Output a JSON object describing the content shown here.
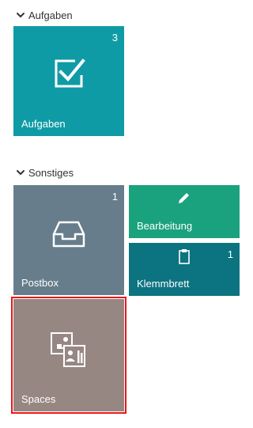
{
  "sections": [
    {
      "title": "Aufgaben",
      "tiles": [
        {
          "label": "Aufgaben",
          "count": "3",
          "icon": "checkbox-icon",
          "color": "#0f9ba5"
        }
      ]
    },
    {
      "title": "Sonstiges",
      "tiles": [
        {
          "label": "Postbox",
          "count": "1",
          "icon": "inbox-tray-icon",
          "color": "#677d8b"
        },
        {
          "label": "Bearbeitung",
          "count": "",
          "icon": "pencil-icon",
          "color": "#1aa27e"
        },
        {
          "label": "Klemmbrett",
          "count": "1",
          "icon": "clipboard-icon",
          "color": "#0c7381"
        },
        {
          "label": "Spaces",
          "count": "",
          "icon": "spaces-icon",
          "color": "#978782",
          "selected": true
        }
      ]
    }
  ],
  "colors": {
    "selection_outline": "#e8171b",
    "header_text": "#333333"
  }
}
